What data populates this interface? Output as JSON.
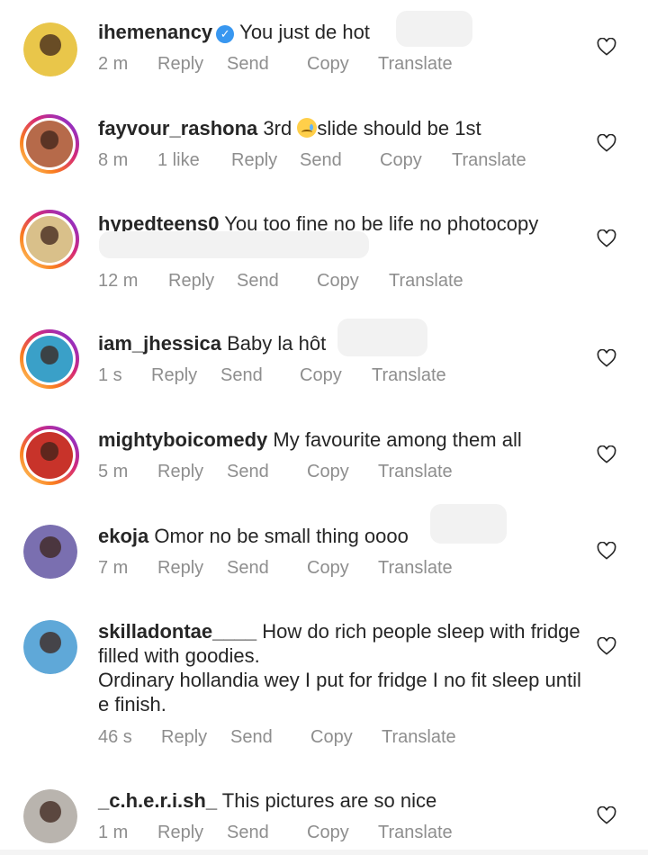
{
  "comments": [
    {
      "username": "ihemenancy",
      "verified": true,
      "text": "You just de hot",
      "time": "2 m",
      "likes": "",
      "reply": "Reply",
      "send": "Send",
      "copy": "Copy",
      "translate": "Translate",
      "avatar_color": "#e9c64a",
      "story_ring": false
    },
    {
      "username": "fayvour_rashona",
      "verified": false,
      "text_before": "3rd",
      "emoji": "crying-face-emoji",
      "text_after": "slide should be 1st",
      "time": "8 m",
      "likes": "1 like",
      "reply": "Reply",
      "send": "Send",
      "copy": "Copy",
      "translate": "Translate",
      "avatar_color": "#b66a4a",
      "story_ring": true
    },
    {
      "username": "hypedteens0",
      "verified": false,
      "text": "You too fine no be life no photocopy",
      "time": "12 m",
      "likes": "",
      "reply": "Reply",
      "send": "Send",
      "copy": "Copy",
      "translate": "Translate",
      "avatar_color": "#d9c08a",
      "story_ring": true
    },
    {
      "username": "iam_jhessica",
      "verified": false,
      "text": "Baby la hôt",
      "time": "1 s",
      "likes": "",
      "reply": "Reply",
      "send": "Send",
      "copy": "Copy",
      "translate": "Translate",
      "avatar_color": "#3aa0c8",
      "story_ring": true
    },
    {
      "username": "mightyboicomedy",
      "verified": false,
      "text": "My favourite  among  them all",
      "time": "5 m",
      "likes": "",
      "reply": "Reply",
      "send": "Send",
      "copy": "Copy",
      "translate": "Translate",
      "avatar_color": "#c8332a",
      "story_ring": true
    },
    {
      "username": "ekoja",
      "verified": false,
      "text": "Omor no be small thing oooo",
      "time": "7 m",
      "likes": "",
      "reply": "Reply",
      "send": "Send",
      "copy": "Copy",
      "translate": "Translate",
      "avatar_color": "#7a6fb0",
      "story_ring": false
    },
    {
      "username": "skilladontae____",
      "verified": false,
      "text": "How do rich people sleep with fridge filled with goodies.",
      "text_line2": "Ordinary hollandia wey I put for fridge I no fit sleep until e finish.",
      "time": "46 s",
      "likes": "",
      "reply": "Reply",
      "send": "Send",
      "copy": "Copy",
      "translate": "Translate",
      "avatar_color": "#5fa8d8",
      "story_ring": false
    },
    {
      "username": "_c.h.e.r.i.sh_",
      "verified": false,
      "text": "This pictures are so nice",
      "time": "1 m",
      "likes": "",
      "reply": "Reply",
      "send": "Send",
      "copy": "Copy",
      "translate": "Translate",
      "avatar_color": "#b9b4ae",
      "story_ring": false
    }
  ],
  "icons": {
    "like": "heart-outline-icon",
    "verified": "verified-badge-icon"
  },
  "colors": {
    "text": "#262626",
    "meta": "#8e8e8e",
    "verified": "#3897f0"
  }
}
